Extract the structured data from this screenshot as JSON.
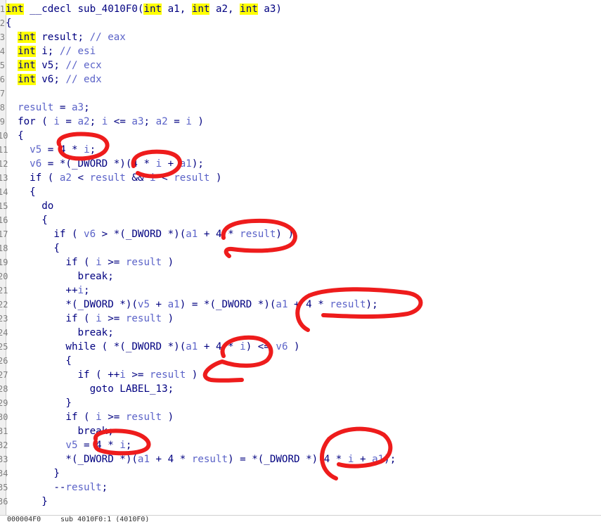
{
  "lines": [
    {
      "n": "1",
      "t": [
        [
          "hl",
          "int"
        ],
        [
          "pl",
          " __cdecl sub_4010F0("
        ],
        [
          "hl",
          "int"
        ],
        [
          "pl",
          " a1, "
        ],
        [
          "hl",
          "int"
        ],
        [
          "pl",
          " a2, "
        ],
        [
          "hl",
          "int"
        ],
        [
          "pl",
          " a3)"
        ]
      ]
    },
    {
      "n": "2",
      "t": [
        [
          "pl",
          "{"
        ]
      ]
    },
    {
      "n": "3",
      "t": [
        [
          "pl",
          "  "
        ],
        [
          "hl",
          "int"
        ],
        [
          "pl",
          " result; "
        ],
        [
          "cm",
          "// eax"
        ]
      ]
    },
    {
      "n": "4",
      "t": [
        [
          "pl",
          "  "
        ],
        [
          "hl",
          "int"
        ],
        [
          "pl",
          " i; "
        ],
        [
          "cm",
          "// esi"
        ]
      ]
    },
    {
      "n": "5",
      "t": [
        [
          "pl",
          "  "
        ],
        [
          "hl",
          "int"
        ],
        [
          "pl",
          " v5; "
        ],
        [
          "cm",
          "// ecx"
        ]
      ]
    },
    {
      "n": "6",
      "t": [
        [
          "pl",
          "  "
        ],
        [
          "hl",
          "int"
        ],
        [
          "pl",
          " v6; "
        ],
        [
          "cm",
          "// edx"
        ]
      ]
    },
    {
      "n": "7",
      "t": []
    },
    {
      "n": "8",
      "t": [
        [
          "pl",
          "  "
        ],
        [
          "var",
          "result"
        ],
        [
          "pl",
          " = "
        ],
        [
          "var",
          "a3"
        ],
        [
          "pl",
          ";"
        ]
      ]
    },
    {
      "n": "9",
      "t": [
        [
          "pl",
          "  for ( "
        ],
        [
          "var",
          "i"
        ],
        [
          "pl",
          " = "
        ],
        [
          "var",
          "a2"
        ],
        [
          "pl",
          "; "
        ],
        [
          "var",
          "i"
        ],
        [
          "pl",
          " <= "
        ],
        [
          "var",
          "a3"
        ],
        [
          "pl",
          "; "
        ],
        [
          "var",
          "a2"
        ],
        [
          "pl",
          " = "
        ],
        [
          "var",
          "i"
        ],
        [
          "pl",
          " )"
        ]
      ]
    },
    {
      "n": "10",
      "t": [
        [
          "pl",
          "  {"
        ]
      ]
    },
    {
      "n": "11",
      "t": [
        [
          "pl",
          "    "
        ],
        [
          "var",
          "v5"
        ],
        [
          "pl",
          " = 4 * "
        ],
        [
          "var",
          "i"
        ],
        [
          "pl",
          ";"
        ]
      ]
    },
    {
      "n": "12",
      "t": [
        [
          "pl",
          "    "
        ],
        [
          "var",
          "v6"
        ],
        [
          "pl",
          " = *(_DWORD *)(4 * "
        ],
        [
          "var",
          "i"
        ],
        [
          "pl",
          " + "
        ],
        [
          "var",
          "a1"
        ],
        [
          "pl",
          ");"
        ]
      ]
    },
    {
      "n": "13",
      "t": [
        [
          "pl",
          "    if ( "
        ],
        [
          "var",
          "a2"
        ],
        [
          "pl",
          " < "
        ],
        [
          "var",
          "result"
        ],
        [
          "pl",
          " && "
        ],
        [
          "var",
          "i"
        ],
        [
          "pl",
          " < "
        ],
        [
          "var",
          "result"
        ],
        [
          "pl",
          " )"
        ]
      ]
    },
    {
      "n": "14",
      "t": [
        [
          "pl",
          "    {"
        ]
      ]
    },
    {
      "n": "15",
      "t": [
        [
          "pl",
          "      do"
        ]
      ]
    },
    {
      "n": "16",
      "t": [
        [
          "pl",
          "      {"
        ]
      ]
    },
    {
      "n": "17",
      "t": [
        [
          "pl",
          "        if ( "
        ],
        [
          "var",
          "v6"
        ],
        [
          "pl",
          " > *(_DWORD *)("
        ],
        [
          "var",
          "a1"
        ],
        [
          "pl",
          " + 4 * "
        ],
        [
          "var",
          "result"
        ],
        [
          "pl",
          ") )"
        ]
      ]
    },
    {
      "n": "18",
      "t": [
        [
          "pl",
          "        {"
        ]
      ]
    },
    {
      "n": "19",
      "t": [
        [
          "pl",
          "          if ( "
        ],
        [
          "var",
          "i"
        ],
        [
          "pl",
          " >= "
        ],
        [
          "var",
          "result"
        ],
        [
          "pl",
          " )"
        ]
      ]
    },
    {
      "n": "20",
      "t": [
        [
          "pl",
          "            break;"
        ]
      ]
    },
    {
      "n": "21",
      "t": [
        [
          "pl",
          "          ++"
        ],
        [
          "var",
          "i"
        ],
        [
          "pl",
          ";"
        ]
      ]
    },
    {
      "n": "22",
      "t": [
        [
          "pl",
          "          *(_DWORD *)("
        ],
        [
          "var",
          "v5"
        ],
        [
          "pl",
          " + "
        ],
        [
          "var",
          "a1"
        ],
        [
          "pl",
          ") = *(_DWORD *)("
        ],
        [
          "var",
          "a1"
        ],
        [
          "pl",
          " + 4 * "
        ],
        [
          "var",
          "result"
        ],
        [
          "pl",
          ");"
        ]
      ]
    },
    {
      "n": "23",
      "t": [
        [
          "pl",
          "          if ( "
        ],
        [
          "var",
          "i"
        ],
        [
          "pl",
          " >= "
        ],
        [
          "var",
          "result"
        ],
        [
          "pl",
          " )"
        ]
      ]
    },
    {
      "n": "24",
      "t": [
        [
          "pl",
          "            break;"
        ]
      ]
    },
    {
      "n": "25",
      "t": [
        [
          "pl",
          "          while ( *(_DWORD *)("
        ],
        [
          "var",
          "a1"
        ],
        [
          "pl",
          " + 4 * "
        ],
        [
          "var",
          "i"
        ],
        [
          "pl",
          ") <= "
        ],
        [
          "var",
          "v6"
        ],
        [
          "pl",
          " )"
        ]
      ]
    },
    {
      "n": "26",
      "t": [
        [
          "pl",
          "          {"
        ]
      ]
    },
    {
      "n": "27",
      "t": [
        [
          "pl",
          "            if ( ++"
        ],
        [
          "var",
          "i"
        ],
        [
          "pl",
          " >= "
        ],
        [
          "var",
          "result"
        ],
        [
          "pl",
          " )"
        ]
      ]
    },
    {
      "n": "28",
      "t": [
        [
          "pl",
          "              goto LABEL_13;"
        ]
      ]
    },
    {
      "n": "29",
      "t": [
        [
          "pl",
          "          }"
        ]
      ]
    },
    {
      "n": "30",
      "t": [
        [
          "pl",
          "          if ( "
        ],
        [
          "var",
          "i"
        ],
        [
          "pl",
          " >= "
        ],
        [
          "var",
          "result"
        ],
        [
          "pl",
          " )"
        ]
      ]
    },
    {
      "n": "31",
      "t": [
        [
          "pl",
          "            break;"
        ]
      ]
    },
    {
      "n": "32",
      "t": [
        [
          "pl",
          "          "
        ],
        [
          "var",
          "v5"
        ],
        [
          "pl",
          " = 4 * "
        ],
        [
          "var",
          "i"
        ],
        [
          "pl",
          ";"
        ]
      ]
    },
    {
      "n": "33",
      "t": [
        [
          "pl",
          "          *(_DWORD *)("
        ],
        [
          "var",
          "a1"
        ],
        [
          "pl",
          " + 4 * "
        ],
        [
          "var",
          "result"
        ],
        [
          "pl",
          ") = *(_DWORD *)(4 * "
        ],
        [
          "var",
          "i"
        ],
        [
          "pl",
          " + "
        ],
        [
          "var",
          "a1"
        ],
        [
          "pl",
          ");"
        ]
      ]
    },
    {
      "n": "34",
      "t": [
        [
          "pl",
          "        }"
        ]
      ]
    },
    {
      "n": "35",
      "t": [
        [
          "pl",
          "        --"
        ],
        [
          "var",
          "result"
        ],
        [
          "pl",
          ";"
        ]
      ]
    },
    {
      "n": "36",
      "t": [
        [
          "pl",
          "      }"
        ]
      ]
    }
  ],
  "status": {
    "address": "000004F0",
    "location": "sub_4010F0:1 (4010F0)"
  },
  "colors": {
    "keyword": "#000080",
    "highlight": "#ffff00",
    "variable": "#5b63c8",
    "annotation": "#ee1c1c"
  }
}
